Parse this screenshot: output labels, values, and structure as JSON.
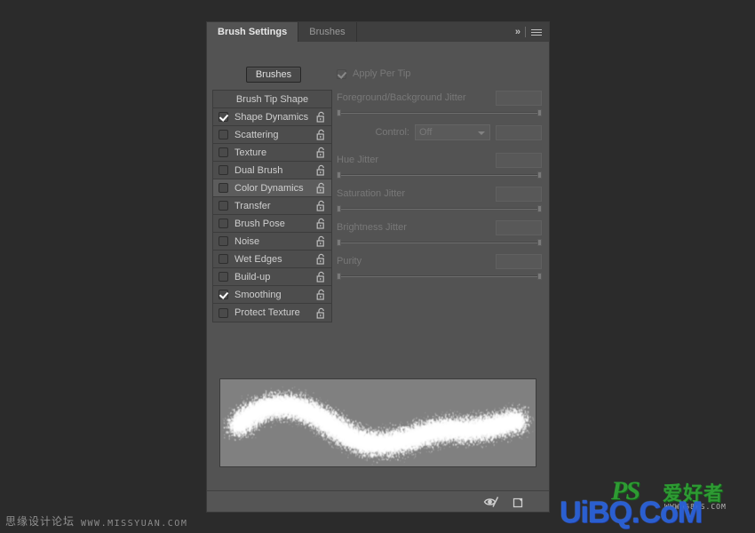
{
  "panel": {
    "tabs": [
      {
        "label": "Brush Settings",
        "active": true
      },
      {
        "label": "Brushes",
        "active": false
      }
    ],
    "expand_icon": "chevron-double-right-icon",
    "menu_icon": "hamburger-menu-icon",
    "brushes_button": "Brushes"
  },
  "options": {
    "header": "Brush Tip Shape",
    "items": [
      {
        "label": "Shape Dynamics",
        "checked": true,
        "selected": false,
        "lock": "unlocked-padlock-icon"
      },
      {
        "label": "Scattering",
        "checked": false,
        "selected": false,
        "lock": "unlocked-padlock-icon"
      },
      {
        "label": "Texture",
        "checked": false,
        "selected": false,
        "lock": "unlocked-padlock-icon"
      },
      {
        "label": "Dual Brush",
        "checked": false,
        "selected": false,
        "lock": "unlocked-padlock-icon"
      },
      {
        "label": "Color Dynamics",
        "checked": false,
        "selected": true,
        "lock": "unlocked-padlock-icon"
      },
      {
        "label": "Transfer",
        "checked": false,
        "selected": false,
        "lock": "unlocked-padlock-icon"
      },
      {
        "label": "Brush Pose",
        "checked": false,
        "selected": false,
        "lock": "unlocked-padlock-icon"
      },
      {
        "label": "Noise",
        "checked": false,
        "selected": false,
        "lock": "unlocked-padlock-icon"
      },
      {
        "label": "Wet Edges",
        "checked": false,
        "selected": false,
        "lock": "unlocked-padlock-icon"
      },
      {
        "label": "Build-up",
        "checked": false,
        "selected": false,
        "lock": "unlocked-padlock-icon"
      },
      {
        "label": "Smoothing",
        "checked": true,
        "selected": false,
        "lock": "unlocked-padlock-icon"
      },
      {
        "label": "Protect Texture",
        "checked": false,
        "selected": false,
        "lock": "unlocked-padlock-icon"
      }
    ]
  },
  "controls": {
    "apply_per_tip": {
      "label": "Apply Per Tip",
      "checked": true,
      "enabled": false
    },
    "fg_bg_jitter": {
      "label": "Foreground/Background Jitter",
      "value": ""
    },
    "control": {
      "label": "Control:",
      "value": "Off",
      "field_value": ""
    },
    "hue_jitter": {
      "label": "Hue Jitter",
      "value": ""
    },
    "saturation_jitter": {
      "label": "Saturation Jitter",
      "value": ""
    },
    "brightness_jitter": {
      "label": "Brightness Jitter",
      "value": ""
    },
    "purity": {
      "label": "Purity",
      "value": ""
    }
  },
  "preview": {
    "name": "brush-stroke-preview",
    "stroke_color": "#ffffff",
    "background_color": "#808080"
  },
  "footer": {
    "live_tip_icon": "eye-toggle-live-brush-tip-icon",
    "new_brush_icon": "create-new-brush-icon"
  },
  "watermarks": {
    "left_cn": "思缘设计论坛",
    "left_url": "WWW.MISSYUAN.COM",
    "right_ps": "PS",
    "right_cn": "爱好者",
    "right_sub": "WWW.68PS.COM",
    "right_brand": "UiBQ.CoM"
  },
  "colors": {
    "panel_bg": "#535353",
    "tabbar_bg": "#3f3f3f",
    "list_bg": "#4d4d4d",
    "selected_row": "#5c5c5c",
    "preview_bg": "#808080",
    "app_bg": "#2b2b2b",
    "brand_blue": "#2a5fd0",
    "brand_green": "#2e9b33"
  }
}
